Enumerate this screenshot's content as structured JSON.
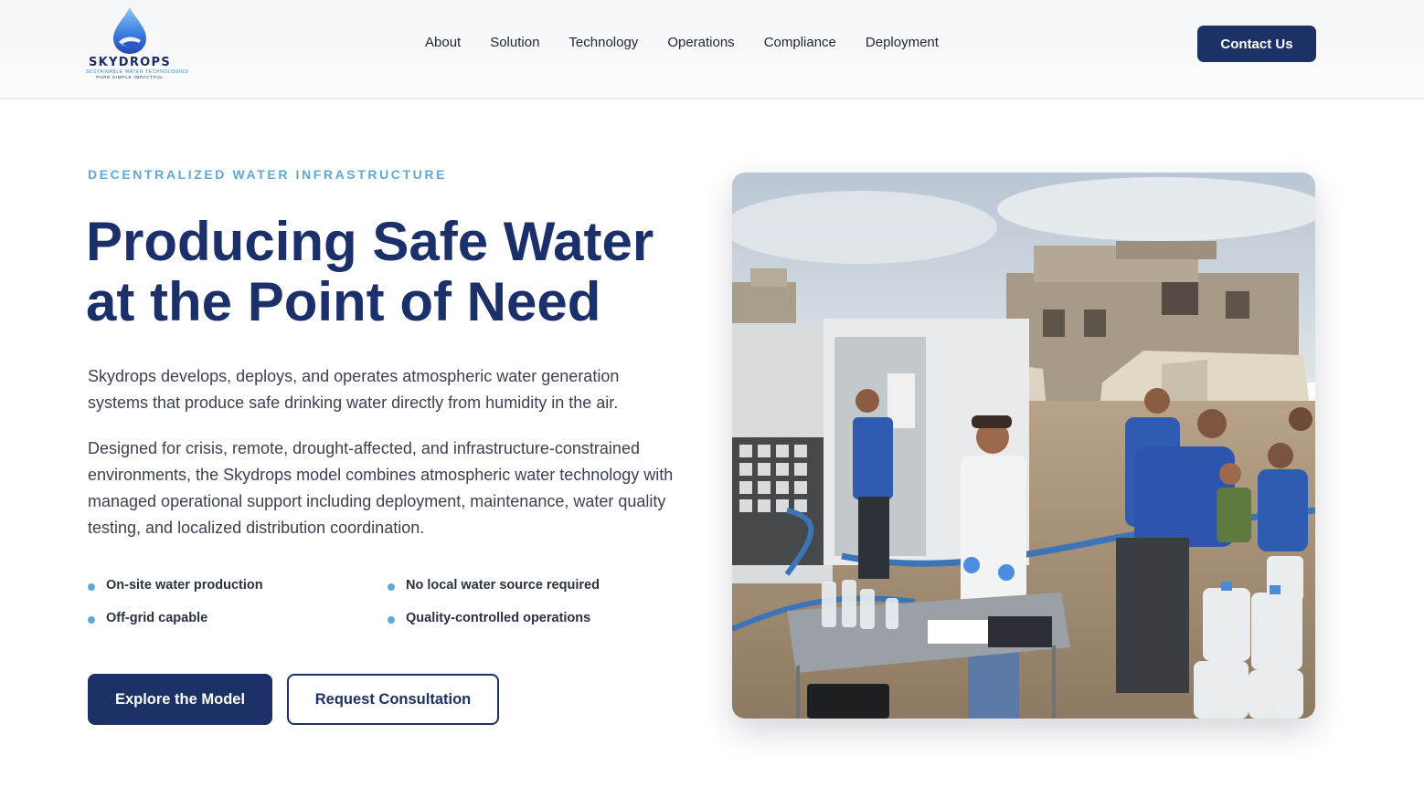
{
  "header": {
    "logo": {
      "wordmark": "SKYDROPS",
      "subline": "SUSTAINABLE WATER TECHNOLOGIES",
      "tagline": "PURE SIMPLE IMPACTFUL"
    },
    "nav": [
      "About",
      "Solution",
      "Technology",
      "Operations",
      "Compliance",
      "Deployment"
    ],
    "contact_label": "Contact Us"
  },
  "hero": {
    "eyebrow": "DECENTRALIZED WATER INFRASTRUCTURE",
    "title_line1": "Producing Safe Water",
    "title_line2": "at the Point of Need",
    "paragraph1": "Skydrops develops, deploys, and operates atmospheric water generation systems that produce safe drinking water directly from humidity in the air.",
    "paragraph2": "Designed for crisis, remote, drought-affected, and infrastructure-constrained environments, the Skydrops model combines atmospheric water technology with managed operational support including deployment, maintenance, water quality testing, and localized distribution coordination.",
    "features": [
      "On-site water production",
      "No local water source required",
      "Off-grid capable",
      "Quality-controlled operations"
    ],
    "primary_cta": "Explore the Model",
    "secondary_cta": "Request Consultation"
  },
  "colors": {
    "brand_navy": "#1c3166",
    "accent_blue": "#5fa8d8",
    "body_text": "#3a4152"
  }
}
